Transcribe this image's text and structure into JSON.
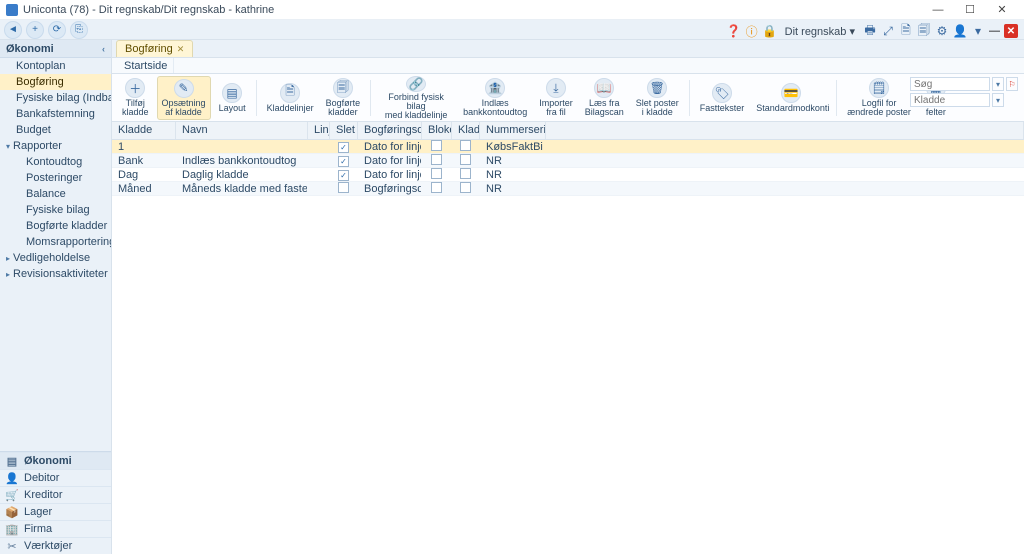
{
  "window": {
    "title": "Uniconta (78)  -  Dit regnskab/Dit regnskab - kathrine",
    "min": "—",
    "max": "☐",
    "close": "✕"
  },
  "quick": {
    "back": "◄",
    "a": "+",
    "b": "⟳",
    "c": "⎘"
  },
  "topright": {
    "help": "❓",
    "info": "ⓘ",
    "lock": "🔒",
    "label": "Dit regnskab ▾",
    "printer": "🖶",
    "maxdoc": "⤢",
    "docup": "🗎",
    "doccopy": "🗐",
    "cfg": "⚙",
    "user": "👤",
    "dd": "▾",
    "off": "✕",
    "dash": "—"
  },
  "panel": {
    "title": "Økonomi",
    "collapse": "‹"
  },
  "tree": [
    {
      "level": 2,
      "label": "Kontoplan",
      "active": false
    },
    {
      "level": 2,
      "label": "Bogføring",
      "active": true
    },
    {
      "level": 2,
      "label": "Fysiske bilag (Indbakke)"
    },
    {
      "level": 2,
      "label": "Bankafstemning"
    },
    {
      "level": 2,
      "label": "Budget"
    },
    {
      "level": 1,
      "label": "Rapporter",
      "caret": true,
      "open": true
    },
    {
      "level": 3,
      "label": "Kontoudtog"
    },
    {
      "level": 3,
      "label": "Posteringer"
    },
    {
      "level": 3,
      "label": "Balance"
    },
    {
      "level": 3,
      "label": "Fysiske bilag"
    },
    {
      "level": 3,
      "label": "Bogførte kladder"
    },
    {
      "level": 3,
      "label": "Momsrapportering"
    },
    {
      "level": 1,
      "label": "Vedligeholdelse",
      "caret": true
    },
    {
      "level": 1,
      "label": "Revisionsaktiviteter",
      "caret": true
    }
  ],
  "modules": [
    {
      "label": "Økonomi",
      "icon": "▤",
      "active": true
    },
    {
      "label": "Debitor",
      "icon": "👤"
    },
    {
      "label": "Kreditor",
      "icon": "🛒"
    },
    {
      "label": "Lager",
      "icon": "📦"
    },
    {
      "label": "Firma",
      "icon": "🏢"
    },
    {
      "label": "Værktøjer",
      "icon": "✂"
    }
  ],
  "tab": {
    "label": "Bogføring",
    "close": "✕"
  },
  "subtab": {
    "label": "Startside"
  },
  "ribbon": [
    {
      "label": "Tilføj\nkladde",
      "icon": "＋"
    },
    {
      "label": "Opsætning\naf kladde",
      "icon": "✎",
      "active": true
    },
    {
      "label": "Layout",
      "icon": "▤",
      "sep": true
    },
    {
      "label": "Kladdelinjer",
      "icon": "🗎"
    },
    {
      "label": "Bogførte\nkladder",
      "icon": "🗐",
      "sep": true
    },
    {
      "label": "Forbind fysisk bilag\nmed kladdelinje",
      "icon": "🔗"
    },
    {
      "label": "Indlæs\nbankkontoudtog",
      "icon": "🏦"
    },
    {
      "label": "Importer\nfra fil",
      "icon": "⤓"
    },
    {
      "label": "Læs fra\nBilagscan",
      "icon": "📖"
    },
    {
      "label": "Slet poster\ni kladde",
      "icon": "🗑",
      "sep": true
    },
    {
      "label": "Fasttekster",
      "icon": "🏷"
    },
    {
      "label": "Standardmodkonti",
      "icon": "💳",
      "sep": true
    },
    {
      "label": "Logfil for\nændrede poster",
      "icon": "🗒"
    },
    {
      "label": "Alle\nfelter",
      "icon": "▦"
    }
  ],
  "search": {
    "placeholder": "Søg",
    "klplaceholder": "Kladde"
  },
  "columns": {
    "kladde": "Kladde",
    "navn": "Navn",
    "linjer": "Linjer",
    "sletli": "Slet li...",
    "bogf": "Bogføringsdatopri...",
    "bloke": "Bloke...",
    "kladd": "Kladd...",
    "numm": "Nummerserie"
  },
  "rows": [
    {
      "kladde": "1",
      "navn": "",
      "sletli": true,
      "bogf": "Dato for linjen",
      "bloke": false,
      "kladd": false,
      "numm": "KøbsFaktBi",
      "sel": true
    },
    {
      "kladde": "Bank",
      "navn": "Indlæs bankkontoudtog",
      "sletli": true,
      "bogf": "Dato for linjen",
      "bloke": false,
      "kladd": false,
      "numm": "NR"
    },
    {
      "kladde": "Dag",
      "navn": "Daglig kladde",
      "sletli": true,
      "bogf": "Dato for linjen",
      "bloke": false,
      "kladd": false,
      "numm": "NR"
    },
    {
      "kladde": "Måned",
      "navn": "Måneds kladde med faste poster",
      "sletli": false,
      "bogf": "Bogføringsdato for...",
      "bloke": false,
      "kladd": false,
      "numm": "NR"
    }
  ]
}
